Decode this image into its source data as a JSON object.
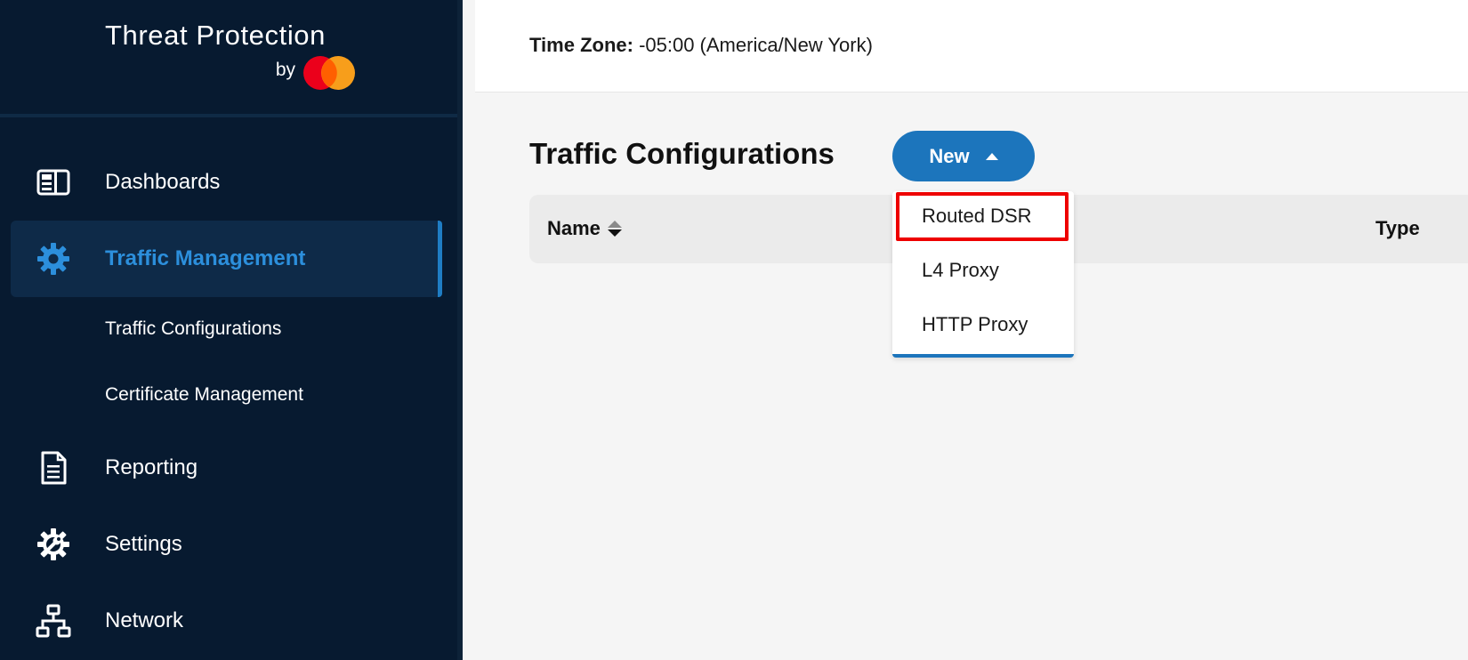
{
  "brand": {
    "title": "Threat Protection",
    "by": "by",
    "logo": "mastercard-logo"
  },
  "sidebar": {
    "items": [
      {
        "label": "Dashboards",
        "icon": "dashboard-icon"
      },
      {
        "label": "Traffic Management",
        "icon": "gear-icon",
        "active": true
      },
      {
        "label": "Reporting",
        "icon": "document-icon"
      },
      {
        "label": "Settings",
        "icon": "settings-wrench-icon"
      },
      {
        "label": "Network",
        "icon": "network-icon"
      }
    ],
    "subitems": [
      {
        "label": "Traffic Configurations"
      },
      {
        "label": "Certificate Management"
      }
    ]
  },
  "header": {
    "tz_label": "Time Zone:",
    "tz_value": " -05:00 (America/New York)"
  },
  "main": {
    "title": "Traffic Configurations",
    "new_button": "New",
    "columns": {
      "name": "Name",
      "type": "Type"
    },
    "new_menu": [
      "Routed DSR",
      "L4 Proxy",
      "HTTP Proxy"
    ],
    "highlighted_option": "Routed DSR"
  },
  "colors": {
    "sidebar_bg": "#071a30",
    "accent": "#1c75bc",
    "active_text": "#2c8fdc",
    "highlight": "#ee0000"
  }
}
